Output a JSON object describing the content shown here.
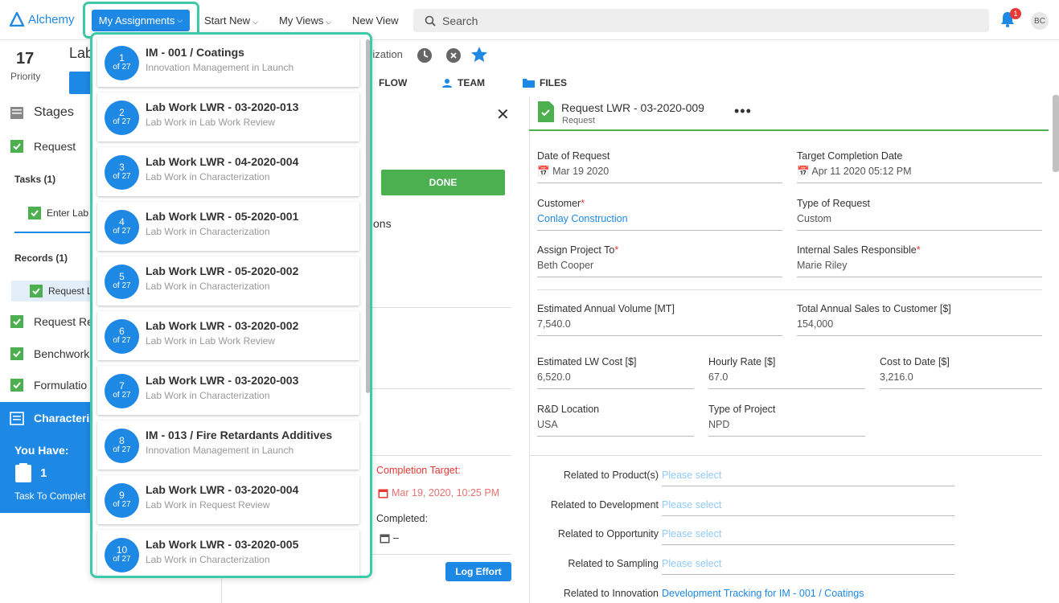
{
  "topbar": {
    "logo": "Alchemy",
    "my_assignments": "My Assignments",
    "start_new": "Start New",
    "my_views": "My Views",
    "new_view": "New View",
    "search_placeholder": "Search",
    "notification_count": "1",
    "user_initials": "BC"
  },
  "header": {
    "priority_number": "17",
    "priority_label": "Priority",
    "record_title_fragment": "Lab",
    "record_subtitle_fragment": "rization",
    "tabs": [
      "FLOW",
      "TEAM",
      "FILES"
    ]
  },
  "sidebar": {
    "title": "Stages",
    "request": "Request",
    "tasks": "Tasks (1)",
    "task_item": "Enter Lab",
    "records": "Records (1)",
    "record_item": "Request L",
    "stages": [
      "Request Re",
      "Benchwork",
      "Formulatio",
      "Characteriz"
    ],
    "you_have": "You Have:",
    "task_count": "1",
    "task_to_complete": "Task To Complet"
  },
  "middle": {
    "done": "DONE",
    "ons_fragment": "ons",
    "completion_target_label": "Completion Target:",
    "completion_target_value": "Mar 19, 2020, 10:25 PM",
    "completed_label": "Completed:",
    "completed_value": "–",
    "log_effort": "Log Effort"
  },
  "form": {
    "title": "Request LWR - 03-2020-009",
    "subtitle": "Request",
    "more": "•••",
    "date_of_request_label": "Date of Request",
    "date_of_request": "Mar 19 2020",
    "target_completion_label": "Target Completion Date",
    "target_completion": "Apr 11 2020 05:12 PM",
    "customer_label": "Customer",
    "customer": "Conlay Construction",
    "type_of_request_label": "Type of Request",
    "type_of_request": "Custom",
    "assign_project_label": "Assign Project To",
    "assign_project": "Beth Cooper",
    "internal_sales_label": "Internal Sales Responsible",
    "internal_sales": "Marie Riley",
    "annual_volume_label": "Estimated Annual Volume [MT]",
    "annual_volume": "7,540.0",
    "total_sales_label": "Total Annual Sales to Customer [$]",
    "total_sales": "154,000",
    "lw_cost_label": "Estimated LW Cost [$]",
    "lw_cost": "6,520.0",
    "hourly_rate_label": "Hourly Rate [$]",
    "hourly_rate": "67.0",
    "cost_to_date_label": "Cost to Date [$]",
    "cost_to_date": "3,216.0",
    "rd_location_label": "R&D Location",
    "rd_location": "USA",
    "project_type_label": "Type of Project",
    "project_type": "NPD",
    "related": [
      {
        "label": "Related to Product(s)",
        "value": "Please select"
      },
      {
        "label": "Related to Development",
        "value": "Please select"
      },
      {
        "label": "Related to Opportunity",
        "value": "Please select"
      },
      {
        "label": "Related to Sampling",
        "value": "Please select"
      },
      {
        "label": "Related to Innovation",
        "value": "Development Tracking for IM - 001 / Coatings"
      }
    ]
  },
  "assignments": [
    {
      "num": "1",
      "of": "of 27",
      "title": "IM - 001 / Coatings",
      "sub": "Innovation Management in Launch"
    },
    {
      "num": "2",
      "of": "of 27",
      "title": "Lab Work LWR - 03-2020-013",
      "sub": "Lab Work in Lab Work Review"
    },
    {
      "num": "3",
      "of": "of 27",
      "title": "Lab Work LWR - 04-2020-004",
      "sub": "Lab Work in Characterization"
    },
    {
      "num": "4",
      "of": "of 27",
      "title": "Lab Work LWR - 05-2020-001",
      "sub": "Lab Work in Characterization"
    },
    {
      "num": "5",
      "of": "of 27",
      "title": "Lab Work LWR - 05-2020-002",
      "sub": "Lab Work in Characterization"
    },
    {
      "num": "6",
      "of": "of 27",
      "title": "Lab Work LWR - 03-2020-002",
      "sub": "Lab Work in Lab Work Review"
    },
    {
      "num": "7",
      "of": "of 27",
      "title": "Lab Work LWR - 03-2020-003",
      "sub": "Lab Work in Characterization"
    },
    {
      "num": "8",
      "of": "of 27",
      "title": "IM - 013 / Fire Retardants Additives",
      "sub": "Innovation Management in Launch"
    },
    {
      "num": "9",
      "of": "of 27",
      "title": "Lab Work LWR - 03-2020-004",
      "sub": "Lab Work in Request Review"
    },
    {
      "num": "10",
      "of": "of 27",
      "title": "Lab Work LWR - 03-2020-005",
      "sub": "Lab Work in Characterization"
    }
  ],
  "colors": {
    "accent": "#1e88e5",
    "highlight": "#3ec9a7",
    "success": "#4caf50"
  }
}
